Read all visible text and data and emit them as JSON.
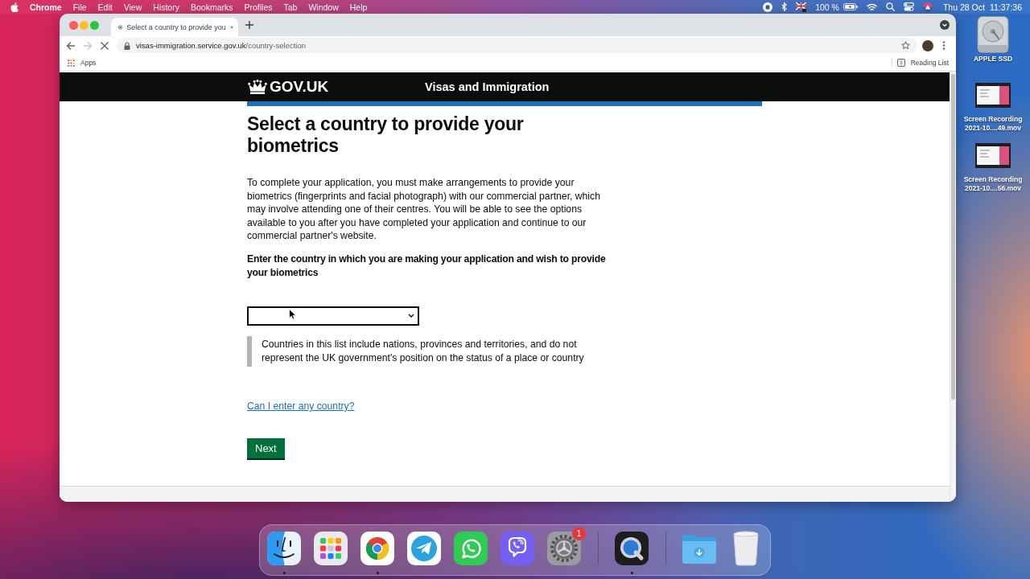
{
  "menu_bar": {
    "app_name": "Chrome",
    "menus": [
      "File",
      "Edit",
      "View",
      "History",
      "Bookmarks",
      "Profiles",
      "Tab",
      "Window",
      "Help"
    ],
    "battery_reading": "100 %",
    "date": "Thu 28 Oct",
    "time": "11:37:36"
  },
  "browser": {
    "tabs": [
      {
        "title": "Select a country to provide you",
        "selected": true
      }
    ],
    "back": {
      "disabled": false
    },
    "forward": {
      "disabled": true
    },
    "loading": true,
    "address": {
      "host": "visas-immigration.service.gov.uk",
      "path": "/country-selection"
    },
    "bookmarks": [
      {
        "label": "Apps"
      }
    ],
    "reading_list": "Reading List"
  },
  "page": {
    "header": {
      "logo": "GOV.UK",
      "service_name": "Visas and Immigration"
    },
    "heading": "Select a country to provide your biometrics",
    "intro": "To complete your application, you must make arrangements to provide your biometrics (fingerprints and facial photograph) with our commercial partner, which may involve attending one of their centres. You will be able to see the options available to you after you have completed your application and continue to our commercial partner's website.",
    "question": "Enter the country in which you are making your application and wish to provide your biometrics",
    "inset_text": "Countries in this list include nations, provinces and territories, and do not represent the UK government's position on the status of a place or country",
    "help_link": "Can I enter any country?",
    "next_button": "Next"
  },
  "desktop": {
    "icons": [
      {
        "kind": "drive",
        "label": "APPLE SSD"
      },
      {
        "kind": "video",
        "label": "Screen Recording 2021-10....49.mov"
      },
      {
        "kind": "video",
        "label": "Screen Recording 2021-10....56.mov"
      }
    ]
  },
  "dock": {
    "groups": [
      {
        "items": [
          {
            "kind": "finder",
            "running": true
          },
          {
            "kind": "launchpad",
            "running": false
          },
          {
            "kind": "chrome",
            "running": true
          },
          {
            "kind": "telegram",
            "running": false
          },
          {
            "kind": "whatsapp",
            "running": false
          },
          {
            "kind": "viber",
            "running": false
          },
          {
            "kind": "settings",
            "running": false,
            "badge": "1"
          }
        ]
      },
      {
        "items": [
          {
            "kind": "quicktime",
            "running": true
          }
        ]
      },
      {
        "items": [
          {
            "kind": "downloads",
            "running": false
          },
          {
            "kind": "trash",
            "running": false
          }
        ]
      }
    ]
  }
}
